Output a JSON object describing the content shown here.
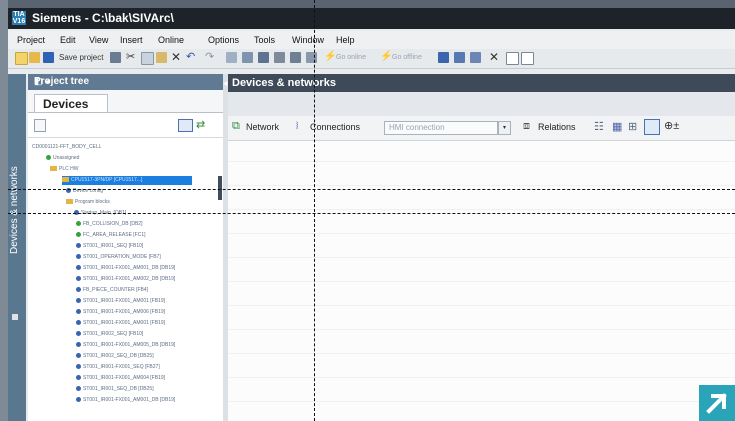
{
  "window": {
    "title": "Siemens  -  C:\\bak\\SIVArc\\",
    "logo_line1": "TIA",
    "logo_line2": "V16"
  },
  "menu": [
    "Project",
    "Edit",
    "View",
    "Insert",
    "Online",
    "Options",
    "Tools",
    "Window",
    "Help"
  ],
  "toolbar": {
    "save_label": "Save project",
    "go_online": "Go online",
    "go_offline": "Go offline"
  },
  "project_tree": {
    "header": "Project tree",
    "side_tab": "Devices & networks",
    "devices_tab": "Devices",
    "items": [
      "CD0001121-FFT_BODY_CELL",
      "Unassigned",
      "PLC HW",
      "CPU1517-3PN/DP [CPU1517...]",
      "Device config",
      "Program blocks",
      "Startup, Main, [OB1]",
      "FB_COLLISION_DB [DB2]",
      "FC_AREA_RELEASE [FC1]",
      "ST001_IR001_SEQ [FB10]",
      "ST001_OPERATION_MODE [FB7]",
      "ST001_IR001-FX001_AM001_DB [DB19]",
      "ST001_IR001-FX001_AM002_DB [DB19]",
      "FB_PIECE_COUNTER [FB4]",
      "ST001_IR001-FX001_AM001 [FB19]",
      "ST001_IR001-FX001_AM006 [FB19]",
      "ST001_IR001-FX001_AM001 [FB19]",
      "ST001_IR002_SEQ [FB10]",
      "ST001_IR001-FX001_AM005_DB [DB19]",
      "ST001_IR002_SEQ_DB [DB25]",
      "ST001_IR001-FX001_SEQ [FB27]",
      "ST001_IR001-FX001_AM004 [FB19]",
      "ST001_IR001_SEQ_DB [DB25]",
      "ST001_IR001-FX001_AM001_DB [DB19]"
    ]
  },
  "devices_networks": {
    "header": "Devices & networks",
    "network_label": "Network",
    "connections_label": "Connections",
    "hmi_combo": "HMI connection",
    "relations_label": "Relations"
  },
  "colors": {
    "title_bar": "#1e232a",
    "panel_header": "#3e4a58",
    "tree_header": "#5f7a92",
    "selection": "#1c7fe0",
    "corner_icon": "#2aa4b8"
  }
}
